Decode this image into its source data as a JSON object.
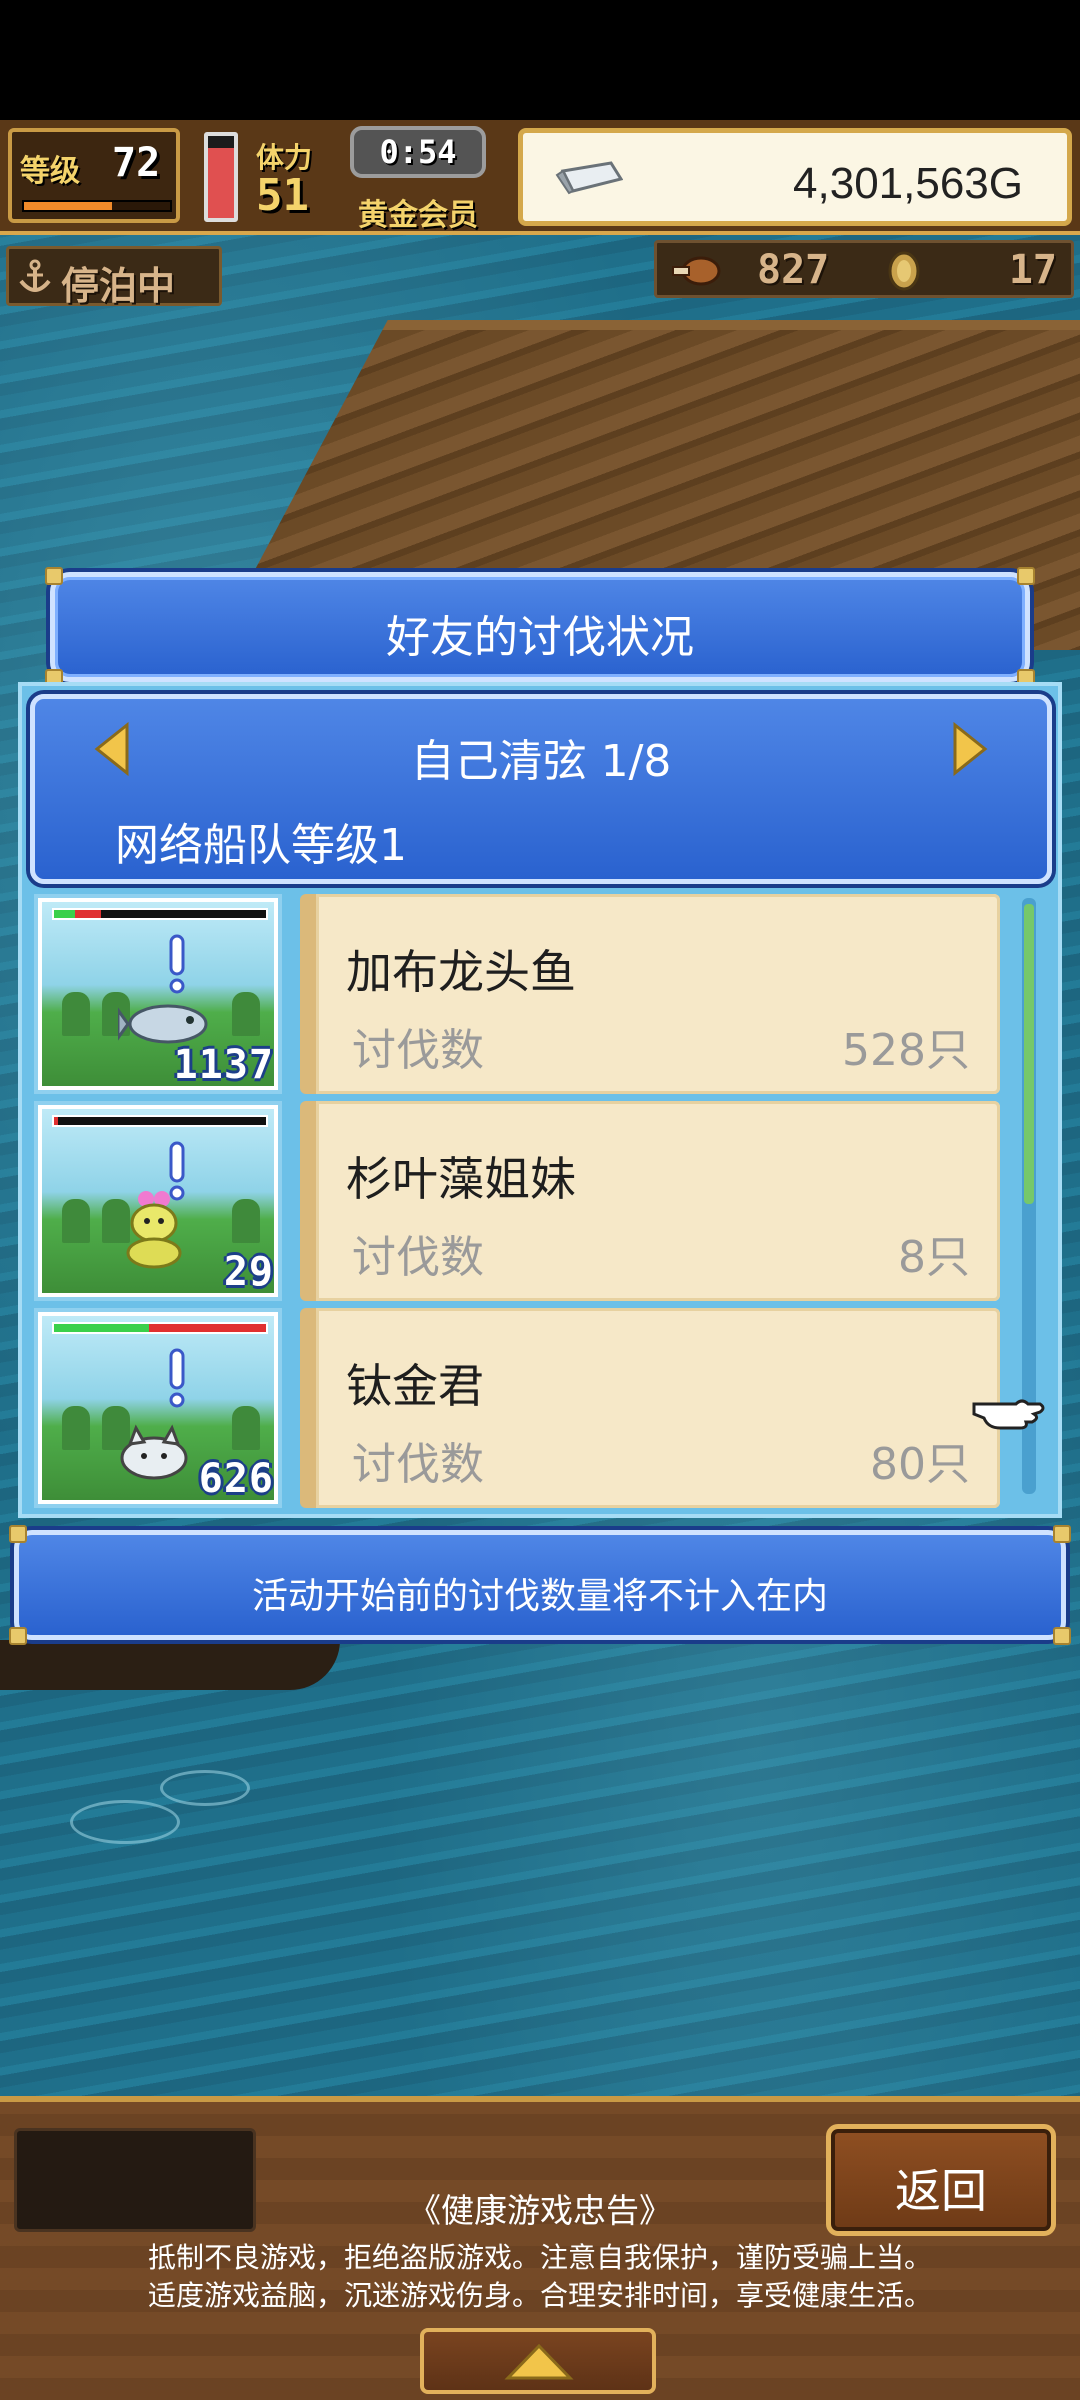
{
  "hud": {
    "level_label": "等级",
    "level": "72",
    "exp_fraction": 0.6,
    "stamina_label": "体力",
    "stamina": "51",
    "stamina_fraction": 0.85,
    "timer": "0:54",
    "membership": "黄金会员",
    "gold": "4,301,563G",
    "status": "停泊中",
    "resource_1": "827",
    "resource_2": "17"
  },
  "dialog": {
    "title": "好友的讨伐状况",
    "friend_name_page": "自己清弦 1/8",
    "fleet_level": "网络船队等级1",
    "kill_label": "讨伐数",
    "notice": "活动开始前的讨伐数量将不计入在内",
    "monsters": [
      {
        "name": "加布龙头鱼",
        "kills": "528只",
        "badge": "1137",
        "hp_green": 0.1,
        "hp_red": 0.12
      },
      {
        "name": "杉叶藻姐妹",
        "kills": "8只",
        "badge": "29",
        "hp_green": 0.0,
        "hp_red": 0.02
      },
      {
        "name": "钛金君",
        "kills": "80只",
        "badge": "626",
        "hp_green": 0.45,
        "hp_red": 0.55
      }
    ]
  },
  "bottom": {
    "back_label": "返回",
    "advice_title": "《健康游戏忠告》",
    "advice_line_1": "抵制不良游戏，拒绝盗版游戏。注意自我保护，谨防受骗上当。",
    "advice_line_2": "适度游戏益脑，沉迷游戏伤身。合理安排时间，享受健康生活。"
  },
  "icons": {
    "silver": "silver-ingot-icon",
    "anchor": "anchor-icon",
    "pointer": "pointing-hand-icon"
  }
}
